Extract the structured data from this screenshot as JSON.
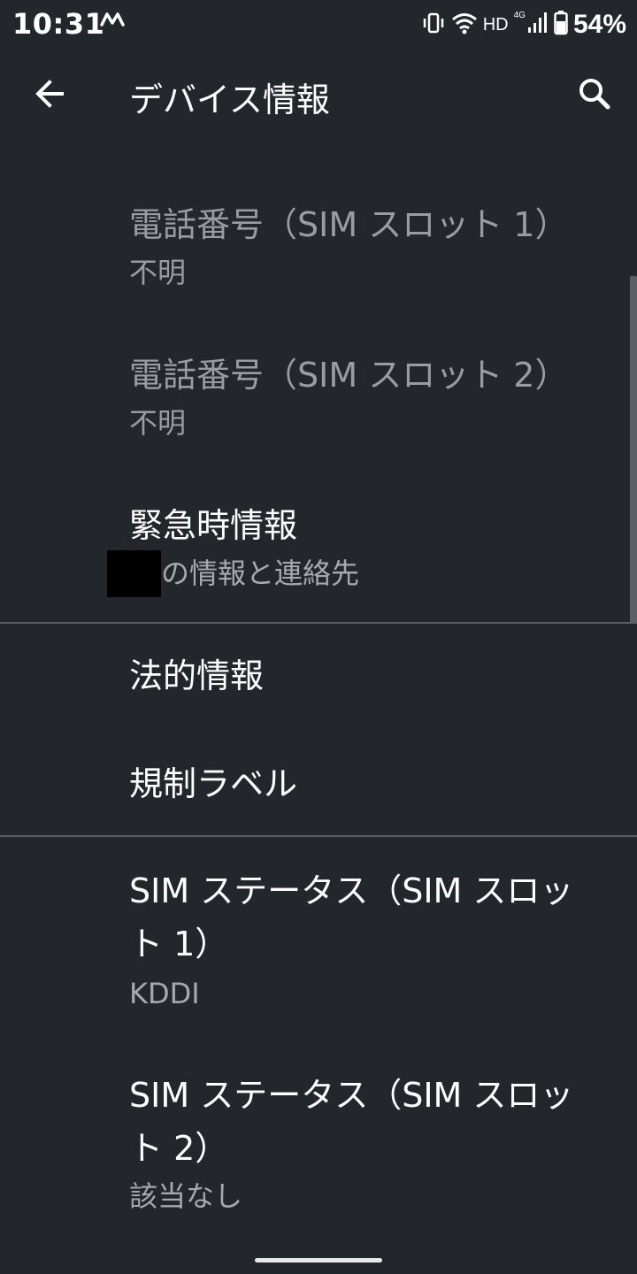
{
  "status_bar": {
    "time": "10:31",
    "hd": "HD",
    "network": "4G",
    "battery": "54%"
  },
  "app_bar": {
    "title": "デバイス情報",
    "back_icon": "arrow-left-icon",
    "search_icon": "search-icon"
  },
  "items": [
    {
      "title": "電話番号（SIM スロット 1）",
      "subtitle": "不明",
      "enabled": false
    },
    {
      "title": "電話番号（SIM スロット 2）",
      "subtitle": "不明",
      "enabled": false
    },
    {
      "title": "緊急時情報",
      "subtitle": "の情報と連絡先",
      "enabled": true
    },
    {
      "title": "法的情報",
      "enabled": true
    },
    {
      "title": "規制ラベル",
      "enabled": true
    },
    {
      "title_line1": "SIM ステータス（SIM スロッ",
      "title_line2": "ト 1）",
      "subtitle": "KDDI",
      "enabled": true
    },
    {
      "title_line1": "SIM ステータス（SIM スロッ",
      "title_line2": "ト 2）",
      "subtitle": "該当なし",
      "enabled": true
    }
  ],
  "colors": {
    "background": "#23262b",
    "text_primary": "#ffffff",
    "text_secondary": "#a7a9ac",
    "text_disabled": "#9a9c9f",
    "divider": "#5a5d61"
  }
}
